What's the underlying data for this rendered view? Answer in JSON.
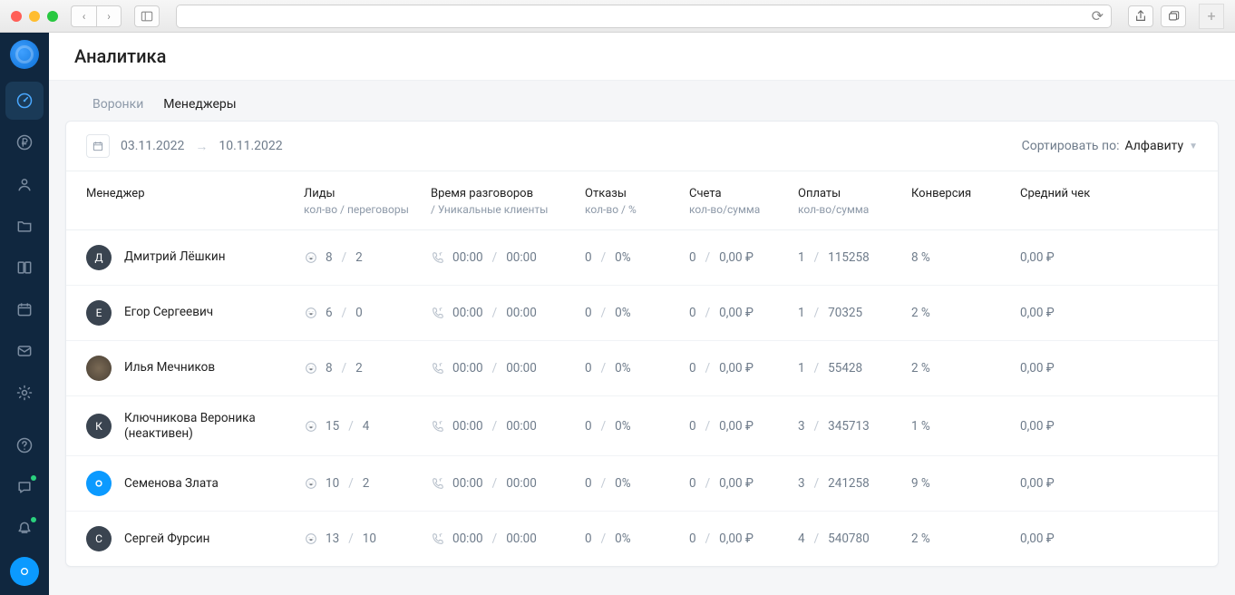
{
  "page": {
    "title": "Аналитика"
  },
  "tabs": {
    "funnels": "Воронки",
    "managers": "Менеджеры"
  },
  "toolbar": {
    "date_from": "03.11.2022",
    "date_to": "10.11.2022",
    "sort_label": "Сортировать по:",
    "sort_value": "Алфавиту"
  },
  "table": {
    "headers": {
      "manager": "Менеджер",
      "leads": "Лиды",
      "leads_sub": "кол-во / переговоры",
      "talk_time": "Время разговоров",
      "talk_time_sub": "/ Уникальные клиенты",
      "refusals": "Отказы",
      "refusals_sub": "кол-во / %",
      "invoices": "Счета",
      "invoices_sub": "кол-во/сумма",
      "payments": "Оплаты",
      "payments_sub": "кол-во/сумма",
      "conversion": "Конверсия",
      "avg_check": "Средний чек"
    },
    "rows": [
      {
        "avatar_letter": "Д",
        "avatar_class": "",
        "name": "Дмитрий Лёшкин",
        "leads_count": "8",
        "leads_nego": "2",
        "talk_a": "00:00",
        "talk_b": "00:00",
        "refusals_count": "0",
        "refusals_pct": "0%",
        "invoices_count": "0",
        "invoices_sum": "0,00 ₽",
        "payments_count": "1",
        "payments_sum": "115258",
        "conversion": "8 %",
        "avg_check": "0,00 ₽"
      },
      {
        "avatar_letter": "Е",
        "avatar_class": "",
        "name": "Егор Сергеевич",
        "leads_count": "6",
        "leads_nego": "0",
        "talk_a": "00:00",
        "talk_b": "00:00",
        "refusals_count": "0",
        "refusals_pct": "0%",
        "invoices_count": "0",
        "invoices_sum": "0,00 ₽",
        "payments_count": "1",
        "payments_sum": "70325",
        "conversion": "2 %",
        "avg_check": "0,00 ₽"
      },
      {
        "avatar_letter": "",
        "avatar_class": "photo",
        "name": "Илья Мечников",
        "leads_count": "8",
        "leads_nego": "2",
        "talk_a": "00:00",
        "talk_b": "00:00",
        "refusals_count": "0",
        "refusals_pct": "0%",
        "invoices_count": "0",
        "invoices_sum": "0,00 ₽",
        "payments_count": "1",
        "payments_sum": "55428",
        "conversion": "2 %",
        "avg_check": "0,00 ₽"
      },
      {
        "avatar_letter": "К",
        "avatar_class": "",
        "name": "Ключникова Вероника (неактивен)",
        "leads_count": "15",
        "leads_nego": "4",
        "talk_a": "00:00",
        "talk_b": "00:00",
        "refusals_count": "0",
        "refusals_pct": "0%",
        "invoices_count": "0",
        "invoices_sum": "0,00 ₽",
        "payments_count": "3",
        "payments_sum": "345713",
        "conversion": "1 %",
        "avg_check": "0,00 ₽"
      },
      {
        "avatar_letter": "",
        "avatar_class": "blue",
        "name": "Семенова Злата",
        "leads_count": "10",
        "leads_nego": "2",
        "talk_a": "00:00",
        "talk_b": "00:00",
        "refusals_count": "0",
        "refusals_pct": "0%",
        "invoices_count": "0",
        "invoices_sum": "0,00 ₽",
        "payments_count": "3",
        "payments_sum": "241258",
        "conversion": "9 %",
        "avg_check": "0,00 ₽"
      },
      {
        "avatar_letter": "С",
        "avatar_class": "",
        "name": "Сергей Фурсин",
        "leads_count": "13",
        "leads_nego": "10",
        "talk_a": "00:00",
        "talk_b": "00:00",
        "refusals_count": "0",
        "refusals_pct": "0%",
        "invoices_count": "0",
        "invoices_sum": "0,00 ₽",
        "payments_count": "4",
        "payments_sum": "540780",
        "conversion": "2 %",
        "avg_check": "0,00 ₽"
      }
    ]
  }
}
